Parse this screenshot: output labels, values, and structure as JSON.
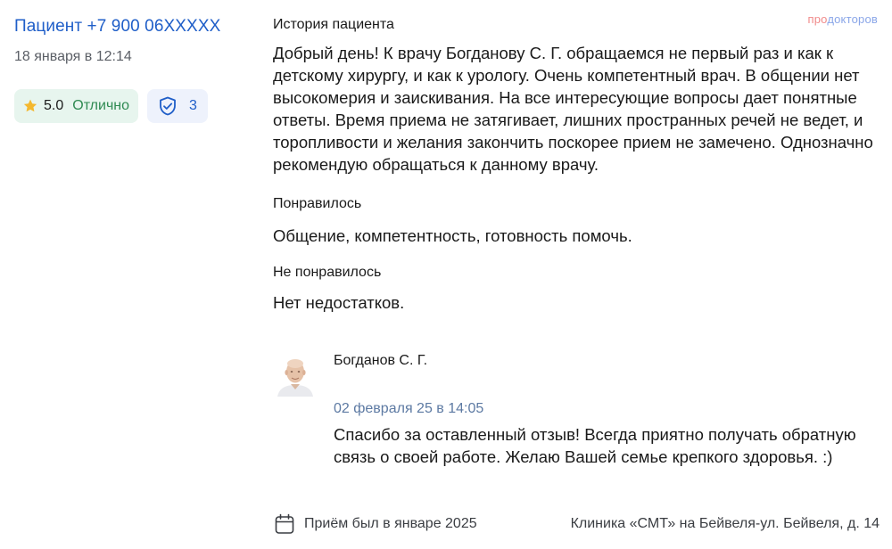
{
  "patient": {
    "name": "Пациент +7 900 06XXXXX",
    "date": "18 января в 12:14"
  },
  "rating": {
    "value": "5.0",
    "label": "Отлично",
    "star_icon": "star-icon",
    "color": "#f4b82e"
  },
  "verified": {
    "count": "3",
    "icon": "shield-check-icon"
  },
  "logo": {
    "part1": "про",
    "part2": "докторов"
  },
  "review": {
    "story_title": "История пациента",
    "story_text": "Добрый день! К врачу Богданову С. Г. обращаемся не первый раз и как к детскому хирургу, и как к урологу. Очень компетентный врач. В общении нет высокомерия и заискивания. На все интересующие вопросы дает понятные ответы. Время приема не затягивает, лишних пространных речей не ведет, и торопливости и желания закончить поскорее прием не замечено. Однозначно рекомендую обращаться к данному врачу.",
    "liked_title": "Понравилось",
    "liked_text": "Общение, компетентность, готовность помочь.",
    "disliked_title": "Не понравилось",
    "disliked_text": "Нет недостатков."
  },
  "reply": {
    "doctor_name": "Богданов С. Г.",
    "date": "02 февраля 25 в 14:05",
    "text": "Спасибо за оставленный отзыв! Всегда приятно получать обратную связь о своей работе. Желаю Вашей семье крепкого здоровья. :)"
  },
  "footer": {
    "visit": "Приём был в январе 2025",
    "clinic": "Клиника «СМТ» на Бейвеля-ул. Бейвеля, д. 14",
    "calendar_icon": "calendar-icon"
  },
  "colors": {
    "link": "#1f5ec8",
    "rating_bg": "#e7f5ee",
    "rating_text": "#2f8a52",
    "verified_bg": "#eef2fc",
    "reply_date": "#5d7aa3"
  }
}
